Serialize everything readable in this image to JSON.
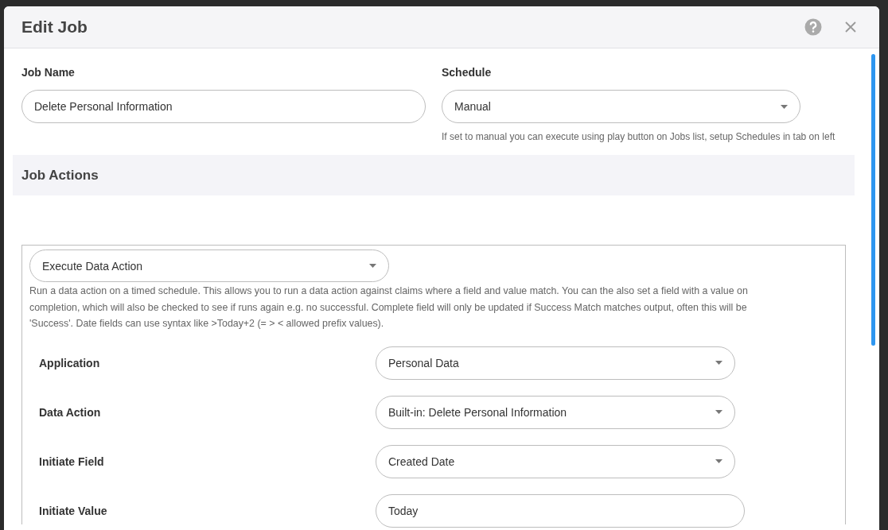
{
  "dialog": {
    "title": "Edit Job"
  },
  "job_name": {
    "label": "Job Name",
    "value": "Delete Personal Information"
  },
  "schedule": {
    "label": "Schedule",
    "value": "Manual",
    "hint": "If set to manual you can execute using play button on Jobs list, setup Schedules in tab on left"
  },
  "job_actions": {
    "heading": "Job Actions",
    "action_type": "Execute Data Action",
    "description": "Run a data action on a timed schedule. This allows you to run a data action against claims where a field and value match. You can the also set a field with a value on completion, which will also be checked to see if runs again e.g. no successful. Complete field will only be updated if Success Match matches output, often this will be 'Success'. Date fields can use syntax like >Today+2 (= > < allowed prefix values).",
    "fields": [
      {
        "kind": "select",
        "label": "Application",
        "value": "Personal Data"
      },
      {
        "kind": "select",
        "label": "Data Action",
        "value": "Built-in: Delete Personal Information"
      },
      {
        "kind": "select",
        "label": "Initiate Field",
        "value": "Created Date"
      },
      {
        "kind": "text",
        "label": "Initiate Value",
        "value": "Today"
      }
    ]
  }
}
